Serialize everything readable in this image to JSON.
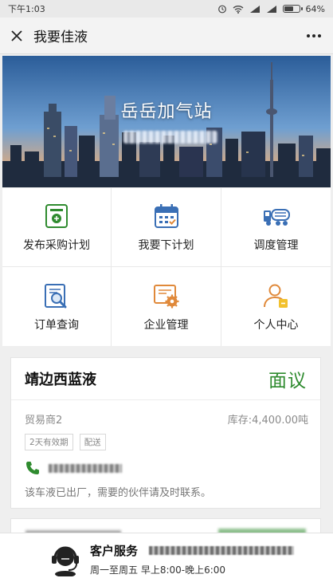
{
  "status_bar": {
    "time": "下午1:03",
    "battery": "64%",
    "battery_level": 0.64
  },
  "navbar": {
    "title": "我要佳液"
  },
  "banner": {
    "station_name": "岳岳加气站"
  },
  "menu": [
    {
      "label": "发布采购计划",
      "icon": "purchase-plan-icon"
    },
    {
      "label": "我要下计划",
      "icon": "calendar-plan-icon"
    },
    {
      "label": "调度管理",
      "icon": "truck-dispatch-icon"
    },
    {
      "label": "订单查询",
      "icon": "order-search-icon"
    },
    {
      "label": "企业管理",
      "icon": "enterprise-gear-icon"
    },
    {
      "label": "个人中心",
      "icon": "user-center-icon"
    }
  ],
  "listing": {
    "title": "靖边西蓝液",
    "price": "面议",
    "seller": "贸易商2",
    "stock": "库存:4,400.00吨",
    "tags": [
      "2天有效期",
      "配送"
    ],
    "notice": "该车液已出厂，需要的伙伴请及时联系。"
  },
  "footer": {
    "title": "客户服务",
    "hours": "周一至周五 早上8:00-晚上6:00"
  },
  "colors": {
    "accent_green": "#2f8b2f",
    "icon_blue": "#3a6fb5",
    "icon_orange": "#e0893a"
  }
}
